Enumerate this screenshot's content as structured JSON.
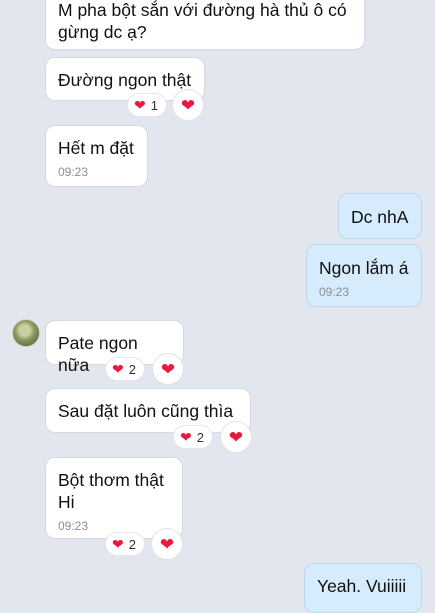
{
  "messages": [
    {
      "id": "m1",
      "text": "M pha bột sắn với đường hà thủ ô có\ngừng dc ạ?"
    },
    {
      "id": "m2",
      "text": "Đường ngon thật",
      "reaction_count": "1"
    },
    {
      "id": "m3",
      "text": "Hết m đặt",
      "time": "09:23"
    },
    {
      "id": "m4",
      "text": "Dc nhA"
    },
    {
      "id": "m5",
      "text": "Ngon lắm á",
      "time": "09:23"
    },
    {
      "id": "m6",
      "text": "Pate ngon nữa",
      "reaction_count": "2"
    },
    {
      "id": "m7",
      "text": "Sau đặt luôn cũng thìa",
      "reaction_count": "2"
    },
    {
      "id": "m8",
      "text": "Bột thơm thật\nHi",
      "time": "09:23",
      "reaction_count": "2"
    },
    {
      "id": "m9",
      "text": "Yeah. Vuiiiii"
    }
  ],
  "icons": {
    "reaction": "heart-icon",
    "avatar": "contact-avatar"
  },
  "colors": {
    "background": "#e2e6ee",
    "incoming": "#ffffff",
    "outgoing": "#d6ebfb",
    "heart": "#e8193c"
  }
}
